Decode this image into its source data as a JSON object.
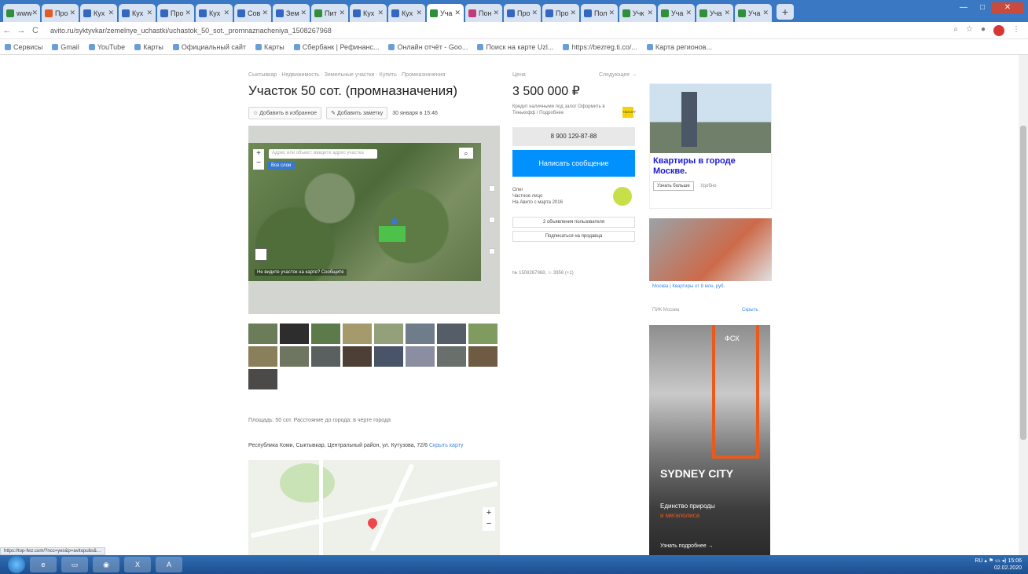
{
  "browser": {
    "tabs": [
      {
        "label": "www",
        "color": "#2f8f3a"
      },
      {
        "label": "Про",
        "color": "#e35b24"
      },
      {
        "label": "Кух",
        "color": "#3467c2"
      },
      {
        "label": "Кух",
        "color": "#3467c2"
      },
      {
        "label": "Про",
        "color": "#3467c2"
      },
      {
        "label": "Кух",
        "color": "#3467c2"
      },
      {
        "label": "Сов",
        "color": "#3467c2"
      },
      {
        "label": "Зем",
        "color": "#3467c2"
      },
      {
        "label": "Пит",
        "color": "#2f8f3a"
      },
      {
        "label": "Кух",
        "color": "#3467c2"
      },
      {
        "label": "Кух",
        "color": "#3467c2"
      },
      {
        "label": "Уча",
        "color": "#2f8f3a"
      },
      {
        "label": "Пон",
        "color": "#c23c7c"
      },
      {
        "label": "Про",
        "color": "#3467c2"
      },
      {
        "label": "Про",
        "color": "#3467c2"
      },
      {
        "label": "Пол",
        "color": "#3467c2"
      },
      {
        "label": "Учк",
        "color": "#2f8f3a"
      },
      {
        "label": "Уча",
        "color": "#2f8f3a"
      },
      {
        "label": "Уча",
        "color": "#2f8f3a"
      },
      {
        "label": "Уча",
        "color": "#2f8f3a"
      }
    ],
    "close_glyph": "✕",
    "new_tab": "+",
    "url": "avito.ru/syktyvkar/zemelnye_uchastki/uchastok_50_sot._promnaznacheniya_1508267968",
    "back": "←",
    "forward": "→",
    "reload": "C",
    "bookmarks": [
      "Сервисы",
      "Gmail",
      "YouTube",
      "Карты",
      "Официальный сайт",
      "Карты",
      "Сбербанк | Рефинанс...",
      "Онлайн отчёт - Goo...",
      "Поиск на карте Uzl...",
      "https://bezreg.ti.co/...",
      "Карта регионов..."
    ],
    "status_url": "https://top-fwz.com/?ncc=yes&p=avitopubs&…"
  },
  "listing": {
    "breadcrumbs": "Сыктывкар · Недвижимость · Земельные участки · Купить · Промназначения",
    "title": "Участок 50 сот. (промназначения)",
    "favorite_label": "Добавить в избранное",
    "note_label": "Добавить заметку",
    "date": "30 января в 15:46",
    "map_search_placeholder": "Адрес или объект: введите адрес участка",
    "map_layers_label": "Все слои",
    "map_caption": "Не видите участок на карте? Сообщите",
    "area_text": "Площадь: 50 сот. Расстояние до города: в черте города",
    "address_text": "Республика Коми, Сыктывкар, Центральный район, ул. Кутузова, 72/6",
    "address_link": "Скрыть карту"
  },
  "sidebar": {
    "price_label": "Цена",
    "compare_label": "Следующее →",
    "price": "3 500 000 ₽",
    "credit_text": "Кредит наличными под залог Оформить в Тинькофф / Подробнее",
    "credit_badge": "TINKOFF",
    "phone": "8 900 129-87-88",
    "message_button": "Написать сообщение",
    "seller_lines": [
      "Олег",
      "Частное лицо",
      "На Авито с марта 2016"
    ],
    "seller_btn1": "2 объявления пользователя",
    "seller_btn2": "Подписаться на продавца",
    "ad_id": "№ 1508267968, ☆ 3956 (+1)"
  },
  "ads": {
    "ad1_title": "Квартиры в городе Москве.",
    "ad1_button": "Узнать больше",
    "ad1_note": "Удобно",
    "ad2_caption": "Москва | Квартиры от 8 млн. руб.",
    "ad2_sub": "ПИК Москва",
    "ad2_hide": "Скрыть",
    "ad3_brand": "ФСК",
    "ad3_logo": "SYDNEY CITY",
    "ad3_text": "Единство природы",
    "ad3_orange": "и мегаполиса",
    "ad3_cta": "Узнать подробнее →"
  },
  "taskbar": {
    "time": "15:06",
    "date": "02.02.2020",
    "lang": "RU"
  }
}
